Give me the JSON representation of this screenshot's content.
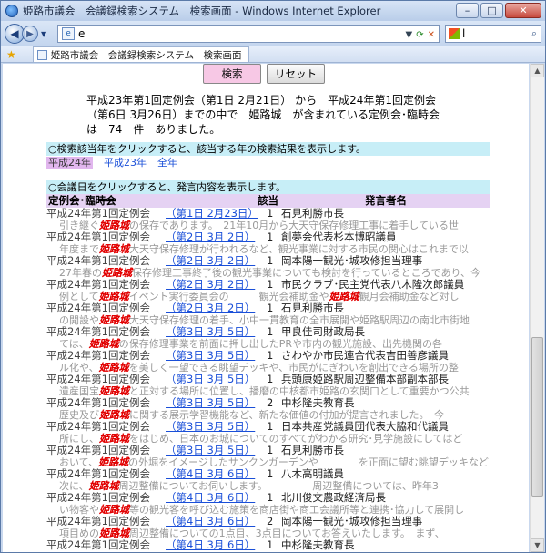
{
  "window": {
    "title": "姫路市議会　会議録検索システム　検索画面 - Windows Internet Explorer",
    "tab_title": "姫路市議会　会議録検索システム　検索画面",
    "address": "e",
    "search_placeholder": "l"
  },
  "page": {
    "search_button": "検索",
    "reset_button": "リセット",
    "summary": "平成23年第1回定例会（第1日 2月21日） から　平成24年第1回定例会（第6日 3月26日）までの中で　姫路城　が含まれている定例会･臨時会　は　74　件　ありました。",
    "year_instruction": "○検索該当年をクリックすると、該当する年の検索結果を表示します。",
    "year_links": [
      {
        "label": "平成24年",
        "selected": true
      },
      {
        "label": "平成23年",
        "selected": false
      },
      {
        "label": "全年",
        "selected": false
      }
    ],
    "day_instruction": "○会議日をクリックすると、発言内容を表示します。",
    "columns": {
      "session": "定例会･臨時会",
      "count": "該当",
      "speaker": "発言者名"
    },
    "keyword": "姫路城",
    "results": [
      {
        "session": "平成24年第1回定例会",
        "day": "（第1日 2月23日）",
        "count": "1",
        "speaker": "石見利勝市長",
        "snip_before": "引き継ぐ",
        "snip_after": "の保存であります。　21年10月から大天守保存修理工事に着手している世"
      },
      {
        "session": "平成24年第1回定例会",
        "day": "（第2日 3月 2日）",
        "count": "1",
        "speaker": "創夢会代表杉本博昭議員",
        "snip_before": "年度まで",
        "snip_after": "大天守保存修理が行われるなど、観光事業に対する市民の関心はこれまで以"
      },
      {
        "session": "平成24年第1回定例会",
        "day": "（第2日 3月 2日）",
        "count": "1",
        "speaker": "岡本陽一観光･城攻修担当理事",
        "snip_before": "27年春の",
        "snip_after": "保存修理工事終了後の観光事業についても検討を行っているところであり、今"
      },
      {
        "session": "平成24年第1回定例会",
        "day": "（第2日 3月 2日）",
        "count": "1",
        "speaker": "市民クラブ･民主党代表八木隆次郎議員",
        "snip_before": "例として",
        "snip_after": "イベント実行委員会の　　　観光会補助金や",
        "kw2_after": "観月会補助金など対し"
      },
      {
        "session": "平成24年第1回定例会",
        "day": "（第2日 3月 2日）",
        "count": "1",
        "speaker": "石見利勝市長",
        "snip_before": "の開設や",
        "snip_after": "大天守保存修理の着手、小中一貫教育の全市展開や姫路駅周辺の南北市街地"
      },
      {
        "session": "平成24年第1回定例会",
        "day": "（第3日 3月 5日）",
        "count": "1",
        "speaker": "甲良佳司財政局長",
        "snip_before": "ては、",
        "snip_after": "の保存修理事業を前面に押し出したPRや市内の観光施設、出先機関の各"
      },
      {
        "session": "平成24年第1回定例会",
        "day": "（第3日 3月 5日）",
        "count": "1",
        "speaker": "さわやか市民連合代表吉田善彦議員",
        "snip_before": "ル化や、",
        "snip_after": "を美しく一望できる眺望デッキや、市民がにぎわいを創出できる場所の整"
      },
      {
        "session": "平成24年第1回定例会",
        "day": "（第3日 3月 5日）",
        "count": "1",
        "speaker": "兵頭康姫路駅周辺整備本部副本部長",
        "snip_before": "遺産国宝",
        "snip_after": "と正対する場所に位置し、播磨の中核都市姫路の玄関口として重要かつ公共"
      },
      {
        "session": "平成24年第1回定例会",
        "day": "（第3日 3月 5日）",
        "count": "2",
        "speaker": "中杉隆夫教育長",
        "snip_before": "歴史及び",
        "snip_after": "に関する展示学習機能など、新たな価値の付加が提言されました。　今"
      },
      {
        "session": "平成24年第1回定例会",
        "day": "（第3日 3月 5日）",
        "count": "1",
        "speaker": "日本共産党議員団代表大脇和代議員",
        "snip_before": "所にし、",
        "snip_after": "をはじめ、日本のお城についてのすべてがわかる研究･見学施設にしてはど"
      },
      {
        "session": "平成24年第1回定例会",
        "day": "（第3日 3月 5日）",
        "count": "1",
        "speaker": "石見利勝市長",
        "snip_before": "おいて、",
        "snip_after": "の外堀をイメージしたサンクンガーデンや　　　　を正面に望む眺望デッキなど"
      },
      {
        "session": "平成24年第1回定例会",
        "day": "（第4日 3月 6日）",
        "count": "1",
        "speaker": "八木高明議員",
        "snip_before": "次に、",
        "snip_after": "周辺整備についてお伺いします。　　　　　周辺整備については、昨年3"
      },
      {
        "session": "平成24年第1回定例会",
        "day": "（第4日 3月 6日）",
        "count": "1",
        "speaker": "北川俊文農政経済局長",
        "snip_before": "い物客や",
        "snip_after": "等の観光客を呼び込む施策を商店街や商工会議所等と連携･協力して展開し"
      },
      {
        "session": "平成24年第1回定例会",
        "day": "（第4日 3月 6日）",
        "count": "2",
        "speaker": "岡本陽一観光･城攻修担当理事",
        "snip_before": "項目めの",
        "snip_after": "周辺整備についての1点目、3点目についてお答えいたします。　まず、"
      },
      {
        "session": "平成24年第1回定例会",
        "day": "（第4日 3月 6日）",
        "count": "1",
        "speaker": "中杉隆夫教育長",
        "snip_before": "",
        "snip_after": ""
      }
    ]
  }
}
